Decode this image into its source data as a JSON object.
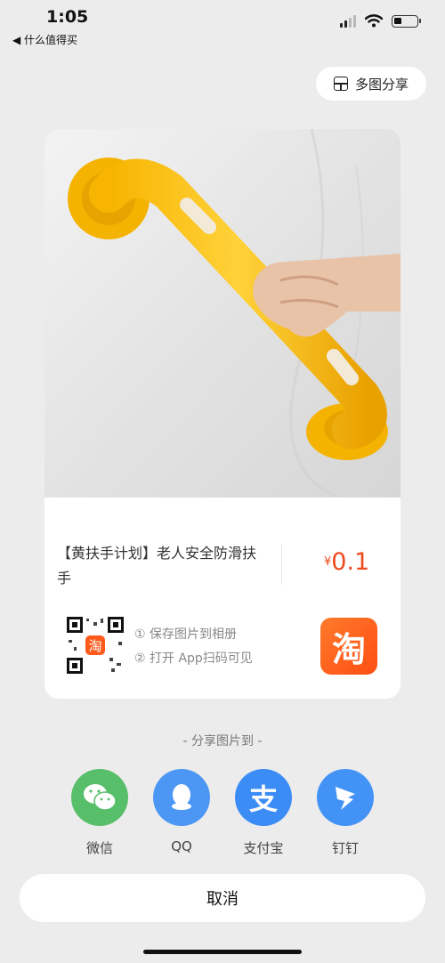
{
  "status_bar": {
    "time": "1:05",
    "back_app": "◀ 什么值得买",
    "icons": [
      "signal-icon",
      "wifi-icon",
      "battery-icon"
    ]
  },
  "header": {
    "multi_share_label": "多图分享"
  },
  "card": {
    "product_title": "【黄扶手计划】老人安全防滑扶手",
    "currency": "¥",
    "price": "0.1",
    "steps": [
      "① 保存图片到相册",
      "② 打开 App扫码可见"
    ],
    "taobao_char": "淘",
    "colors": {
      "price": "#ef4a1e",
      "taobao": "#ff5a1c"
    }
  },
  "share": {
    "title": "- 分享图片到 -",
    "targets": [
      {
        "label": "微信",
        "icon": "wechat-icon",
        "color": "#57be6a"
      },
      {
        "label": "QQ",
        "icon": "qq-icon",
        "color": "#4c97f4"
      },
      {
        "label": "支付宝",
        "icon": "alipay-icon",
        "color": "#3c8cf5"
      },
      {
        "label": "钉钉",
        "icon": "dingtalk-icon",
        "color": "#4393f6"
      }
    ]
  },
  "cancel_label": "取消"
}
